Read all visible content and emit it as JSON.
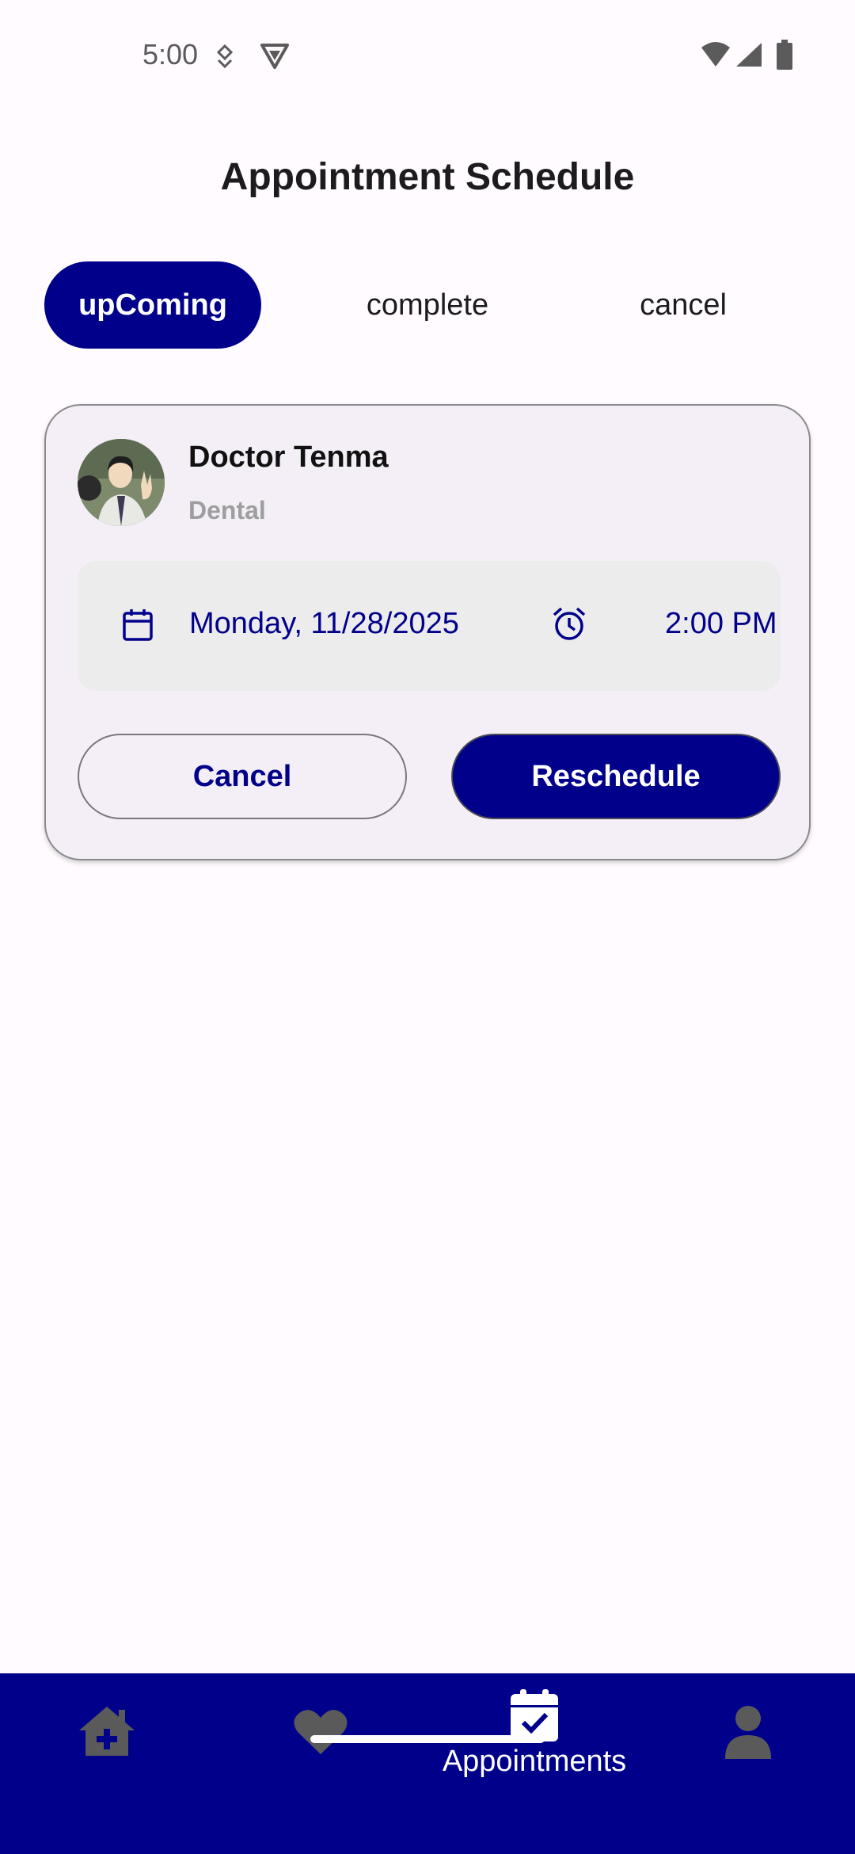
{
  "status_bar": {
    "time": "5:00",
    "icons": [
      "data-saver-icon",
      "shield-icon",
      "wifi-icon",
      "signal-icon",
      "battery-icon"
    ]
  },
  "header": {
    "title": "Appointment Schedule"
  },
  "tabs": [
    {
      "label": "upComing",
      "active": true
    },
    {
      "label": "complete",
      "active": false
    },
    {
      "label": "cancel",
      "active": false
    }
  ],
  "appointment": {
    "doctor_name": "Doctor Tenma",
    "specialty": "Dental",
    "date": "Monday, 11/28/2025",
    "time": "2:00 PM",
    "cancel_label": "Cancel",
    "reschedule_label": "Reschedule"
  },
  "bottom_nav": {
    "items": [
      {
        "icon": "home-medical-icon",
        "label": ""
      },
      {
        "icon": "heart-icon",
        "label": ""
      },
      {
        "icon": "calendar-check-icon",
        "label": "Appointments",
        "active": true
      },
      {
        "icon": "person-icon",
        "label": ""
      }
    ]
  },
  "colors": {
    "primary": "#00008b",
    "card_background": "#f4eff7",
    "panel_background": "#ececec",
    "muted_text": "#9e9e9e"
  }
}
